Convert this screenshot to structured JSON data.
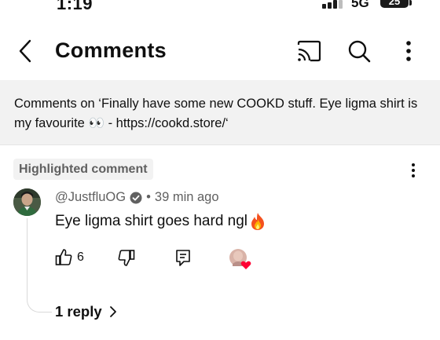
{
  "status_bar": {
    "time": "1:19",
    "network": "5G",
    "battery": "25"
  },
  "header": {
    "title": "Comments"
  },
  "context": {
    "text": "Comments on ‘Finally have some new COOKD stuff. Eye ligma shirt is my favourite 👀 - https://cookd.store/‘"
  },
  "comment": {
    "badge": "Highlighted comment",
    "author": "@JustfluOG",
    "separator": "•",
    "time": "39 min ago",
    "text": "Eye ligma shirt goes hard ngl",
    "like_count": "6",
    "replies_label": "1 reply"
  },
  "colors": {
    "accent_red": "#ff0033",
    "secondary_text": "#606060",
    "panel_bg": "#f2f2f2"
  },
  "icons": [
    "back-icon",
    "cast-icon",
    "search-icon",
    "more-vert-icon",
    "verified-icon",
    "fire-emoji",
    "thumbs-up-icon",
    "thumbs-down-icon",
    "reply-icon",
    "creator-heart-icon",
    "chevron-right-icon"
  ]
}
